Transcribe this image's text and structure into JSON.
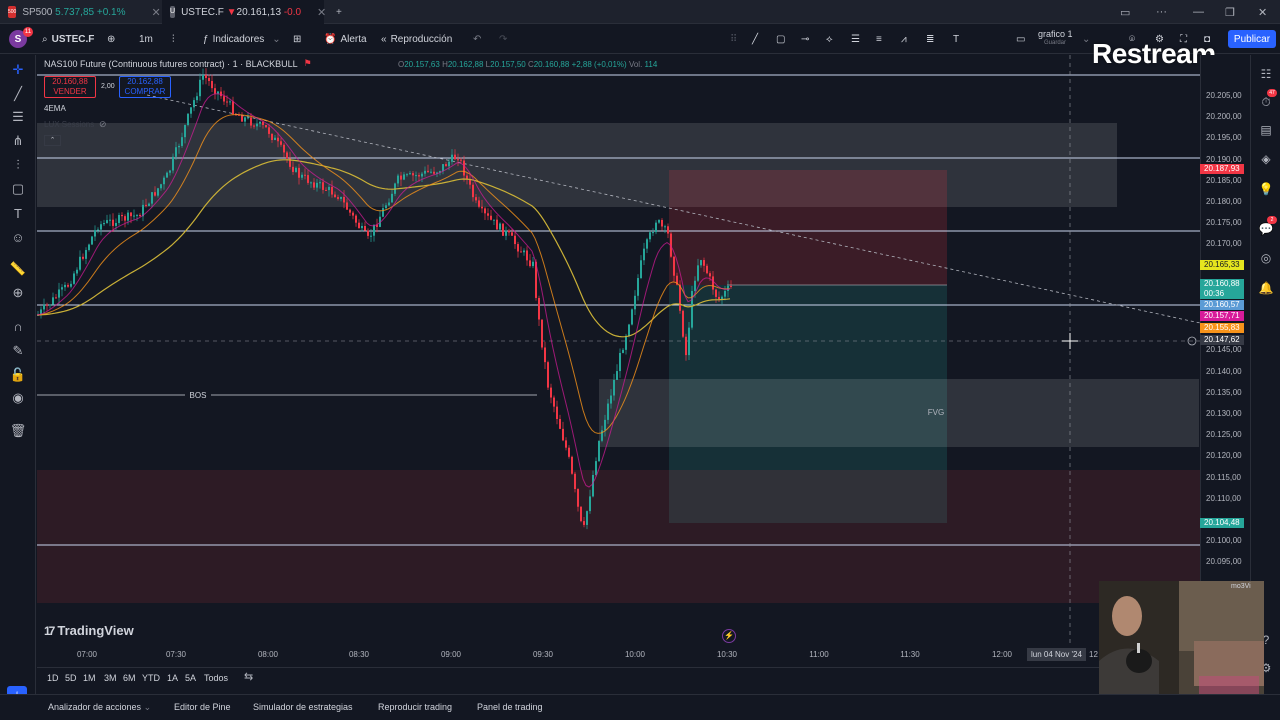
{
  "browser_tabs": [
    {
      "icon_text": "500",
      "symbol": "SP500",
      "price": "5.737,85",
      "change": "+0.1%",
      "direction": "up",
      "active": false
    },
    {
      "icon_text": "U",
      "symbol": "USTEC.F",
      "price": "20.161,13",
      "change": "-0.0",
      "direction": "down",
      "active": true
    }
  ],
  "toolbar": {
    "avatar_letter": "S",
    "avatar_badge": "11",
    "symbol": "USTEC.F",
    "interval": "1m",
    "indicators_label": "Indicadores",
    "alert_label": "Alerta",
    "replay_label": "Reproducción",
    "layout_name": "grafico 1",
    "layout_status": "Guardar",
    "publish_label": "Publicar"
  },
  "overlay_logo": "Restream",
  "chart_header": {
    "title": "NAS100 Future (Continuous futures contract) · 1 · BLACKBULL",
    "open_label": "O",
    "open": "20.157,63",
    "high_label": "H",
    "high": "20.162,88",
    "low_label": "L",
    "low": "20.157,50",
    "close_label": "C",
    "close": "20.160,88",
    "change": "+2,88 (+0,01%)",
    "volume_label": "Vol.",
    "volume": "114"
  },
  "trade": {
    "sell_price": "20.160,88",
    "sell_label": "VENDER",
    "spread": "2,00",
    "buy_price": "20.162,88",
    "buy_label": "COMPRAR"
  },
  "indicator_label": "4EMA",
  "indicator_label_2": "LUX Sessions",
  "annotations": {
    "bos": "BOS",
    "fvg": "FVG"
  },
  "price_scale": {
    "ticks": [
      "20.205,00",
      "20.200,00",
      "20.195,00",
      "20.190,00",
      "20.185,00",
      "20.180,00",
      "20.175,00",
      "20.170,00",
      "20.145,00",
      "20.140,00",
      "20.135,00",
      "20.130,00",
      "20.125,00",
      "20.120,00",
      "20.115,00",
      "20.110,00",
      "20.100,00",
      "20.095,00"
    ],
    "labels": [
      {
        "value": "20.187,93",
        "color": "#f23645"
      },
      {
        "value": "20.165,33",
        "color": "#e5e51f"
      },
      {
        "value": "20.160,88",
        "color": "#26a69a"
      },
      {
        "value": "00:36",
        "color": "#26a69a"
      },
      {
        "value": "20.160,57",
        "color": "#5b9bd5"
      },
      {
        "value": "20.157,71",
        "color": "#d81b9a"
      },
      {
        "value": "20.155,83",
        "color": "#f7931a"
      },
      {
        "value": "20.147,62",
        "color": "#363a45"
      },
      {
        "value": "20.104,48",
        "color": "#26a69a"
      }
    ]
  },
  "time_axis": {
    "ticks": [
      "07:00",
      "07:30",
      "08:00",
      "08:30",
      "09:00",
      "09:30",
      "10:00",
      "10:30",
      "11:00",
      "11:30",
      "12:00"
    ],
    "crosshair_date": "lun 04 Nov '24",
    "crosshair_time": "12"
  },
  "branding": "TradingView",
  "ranges": [
    "1D",
    "5D",
    "1M",
    "3M",
    "6M",
    "YTD",
    "1A",
    "5A",
    "Todos"
  ],
  "bottom_panels": [
    "Analizador de acciones",
    "Editor de Pine",
    "Simulador de estrategias",
    "Reproducir trading",
    "Panel de trading"
  ],
  "right_badges": {
    "alerts": "47",
    "notifications": "2"
  },
  "webcam_caption": "mo3Vi",
  "colors": {
    "background": "#131722",
    "up": "#26a69a",
    "down": "#f23645",
    "accent": "#2962ff",
    "ema_fast": "#d81b9a",
    "ema_mid": "#f7931a",
    "ema_slow": "#c9b037"
  }
}
